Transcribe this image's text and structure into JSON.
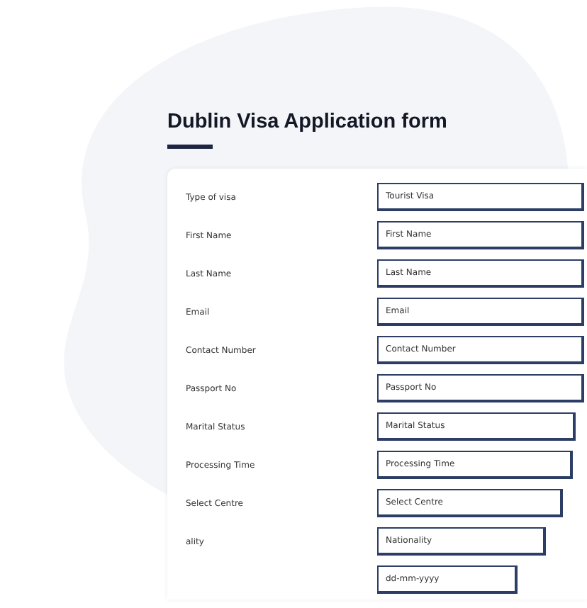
{
  "title": "Dublin Visa Application form",
  "fields": [
    {
      "label": "Type of visa",
      "placeholder": "Tourist Visa"
    },
    {
      "label": "First Name",
      "placeholder": "First Name"
    },
    {
      "label": "Last Name",
      "placeholder": "Last Name"
    },
    {
      "label": "Email",
      "placeholder": "Email"
    },
    {
      "label": "Contact Number",
      "placeholder": "Contact Number"
    },
    {
      "label": "Passport No",
      "placeholder": "Passport No"
    },
    {
      "label": "Marital Status",
      "placeholder": "Marital Status"
    },
    {
      "label": "Processing Time",
      "placeholder": "Processing Time"
    },
    {
      "label": "Select Centre",
      "placeholder": "Select Centre"
    },
    {
      "label": "ality",
      "placeholder": "Nationality"
    },
    {
      "placeholder": "dd-mm-yyyy"
    }
  ]
}
